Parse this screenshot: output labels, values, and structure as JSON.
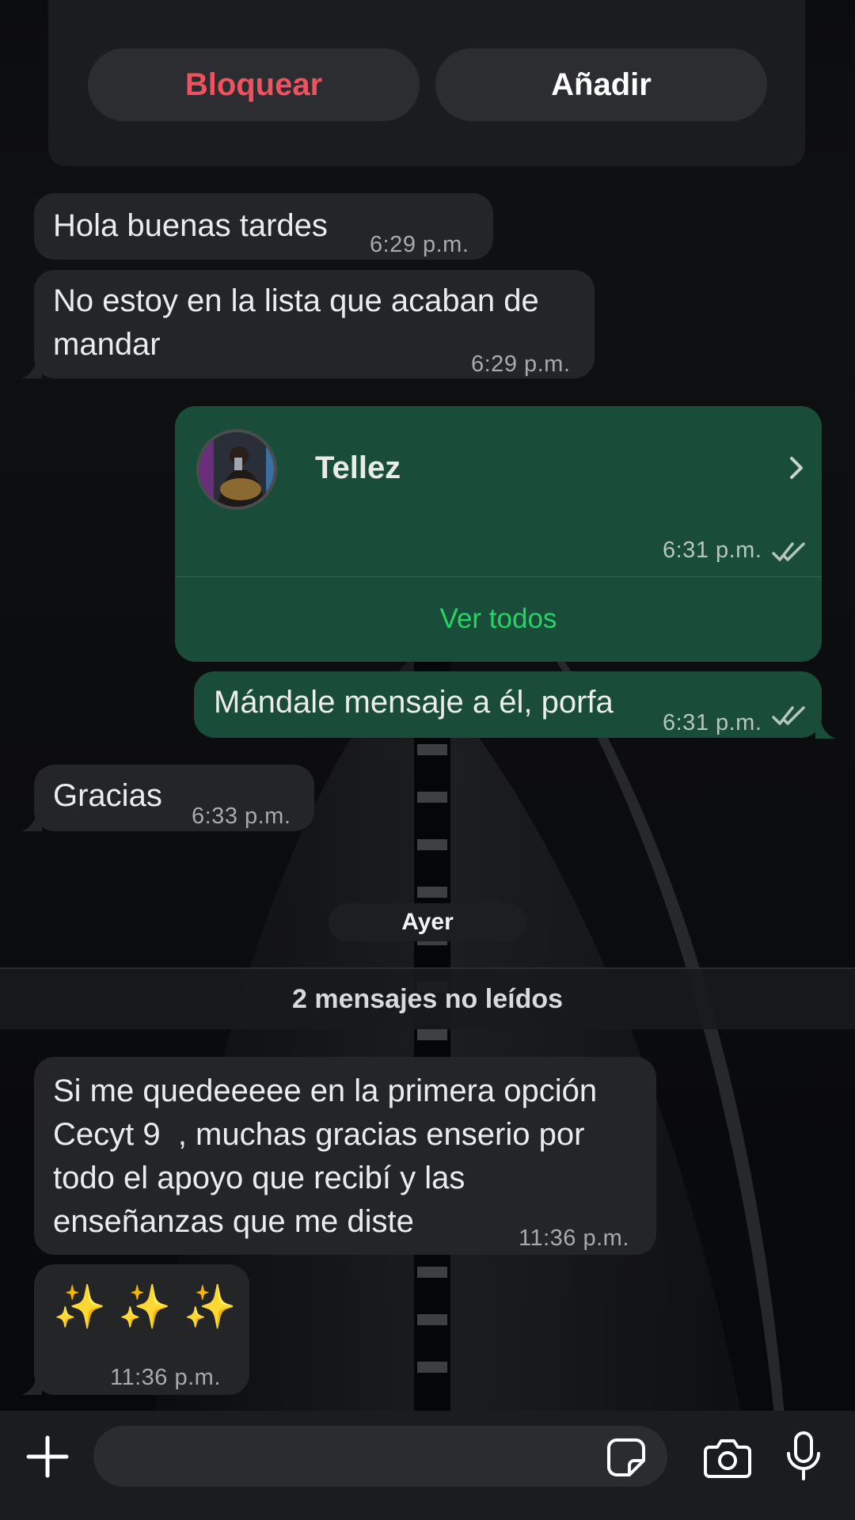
{
  "top_card": {
    "block_label": "Bloquear",
    "add_label": "Añadir"
  },
  "messages": [
    {
      "direction": "in",
      "text": "Hola buenas tardes",
      "time": "6:29 p.m."
    },
    {
      "direction": "in",
      "text": "No estoy en la lista que acaban de\nmandar",
      "time": "6:29 p.m."
    },
    {
      "direction": "out",
      "type": "contact",
      "contact_name": "Tellez",
      "time": "6:31 p.m.",
      "action_label": "Ver todos",
      "status": "read"
    },
    {
      "direction": "out",
      "text": "Mándale mensaje a él, porfa",
      "time": "6:31 p.m.",
      "status": "read"
    },
    {
      "direction": "in",
      "text": "Gracias",
      "time": "6:33 p.m."
    },
    {
      "direction": "in",
      "text": "Si me quedeeeee en la primera opción\nCecyt 9  , muchas gracias enserio por\ntodo el apoyo que recibí y las\nenseñanzas que me diste",
      "time": "11:36 p.m."
    },
    {
      "direction": "in",
      "text": "✨ ✨ ✨",
      "time": "11:36 p.m."
    }
  ],
  "date_separator": "Ayer",
  "unread_banner": "2 mensajes no leídos",
  "input_bar": {
    "placeholder": "",
    "icons": [
      "plus-icon",
      "sticker-icon",
      "camera-icon",
      "microphone-icon"
    ]
  },
  "colors": {
    "incoming_bubble": "#232527",
    "outgoing_bubble": "#1a4d39",
    "block_red": "#f0515f",
    "link_green": "#25d366"
  }
}
